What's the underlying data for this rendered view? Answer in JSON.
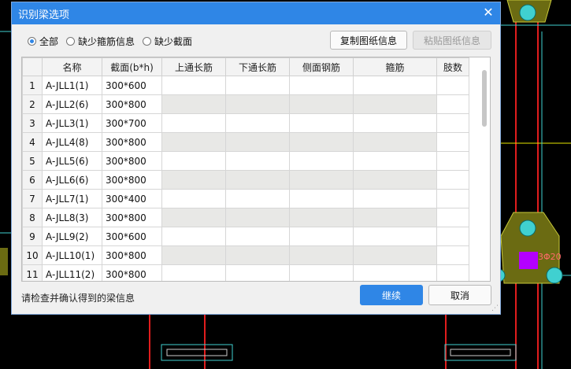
{
  "dialog": {
    "title": "识别梁选项",
    "close_icon": "close-icon",
    "filters": [
      {
        "label": "全部",
        "selected": true
      },
      {
        "label": "缺少箍筋信息",
        "selected": false
      },
      {
        "label": "缺少截面",
        "selected": false
      }
    ],
    "copy_button": "复制图纸信息",
    "paste_button": "粘贴图纸信息",
    "columns": [
      "",
      "名称",
      "截面(b*h)",
      "上通长筋",
      "下通长筋",
      "侧面钢筋",
      "箍筋",
      "肢数"
    ],
    "rows": [
      {
        "idx": "1",
        "name": "A-JLL1(1)",
        "section": "300*600"
      },
      {
        "idx": "2",
        "name": "A-JLL2(6)",
        "section": "300*800"
      },
      {
        "idx": "3",
        "name": "A-JLL3(1)",
        "section": "300*700"
      },
      {
        "idx": "4",
        "name": "A-JLL4(8)",
        "section": "300*800"
      },
      {
        "idx": "5",
        "name": "A-JLL5(6)",
        "section": "300*800"
      },
      {
        "idx": "6",
        "name": "A-JLL6(6)",
        "section": "300*800"
      },
      {
        "idx": "7",
        "name": "A-JLL7(1)",
        "section": "300*400"
      },
      {
        "idx": "8",
        "name": "A-JLL8(3)",
        "section": "300*800"
      },
      {
        "idx": "9",
        "name": "A-JLL9(2)",
        "section": "300*600"
      },
      {
        "idx": "10",
        "name": "A-JLL10(1)",
        "section": "300*800"
      },
      {
        "idx": "11",
        "name": "A-JLL11(2)",
        "section": "300*800"
      }
    ],
    "status_text": "请检查并确认得到的梁信息",
    "continue_button": "继续",
    "cancel_button": "取消"
  },
  "cad": {
    "annotation": "3Φ20",
    "colors": {
      "background": "#000000",
      "red": "#e11d1d",
      "cyan": "#40d0d0",
      "olive": "#6b6b12",
      "magenta": "#b400ff",
      "yellow": "#e8e800",
      "annotation": "#ff6a6a"
    }
  },
  "colors": {
    "accent": "#2f86e6",
    "dialog_bg": "#f0f0f0"
  }
}
